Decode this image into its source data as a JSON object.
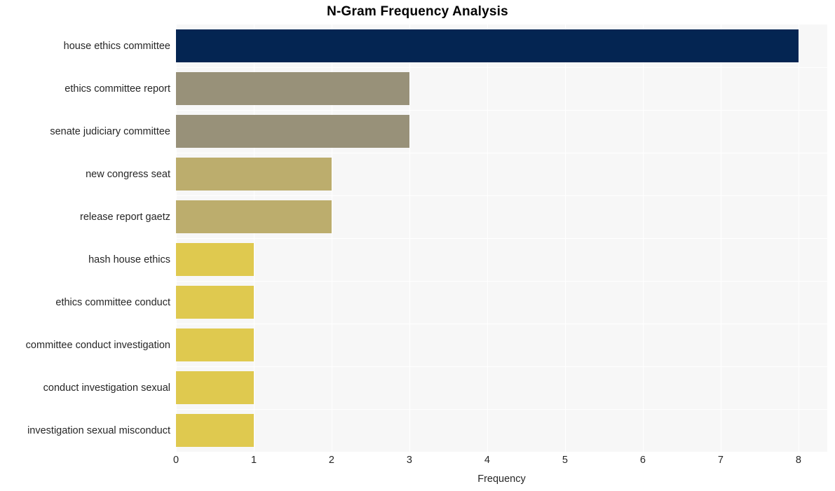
{
  "chart_data": {
    "type": "bar",
    "orientation": "horizontal",
    "title": "N-Gram Frequency Analysis",
    "xlabel": "Frequency",
    "ylabel": "",
    "categories": [
      "house ethics committee",
      "ethics committee report",
      "senate judiciary committee",
      "new congress seat",
      "release report gaetz",
      "hash house ethics",
      "ethics committee conduct",
      "committee conduct investigation",
      "conduct investigation sexual",
      "investigation sexual misconduct"
    ],
    "values": [
      8,
      3,
      3,
      2,
      2,
      1,
      1,
      1,
      1,
      1
    ],
    "bar_colors": [
      "#042552",
      "#989179",
      "#989179",
      "#bcad6d",
      "#bcad6d",
      "#dfc94f",
      "#dfc94f",
      "#dfc94f",
      "#dfc94f",
      "#dfc94f"
    ],
    "xticks": [
      0,
      1,
      2,
      3,
      4,
      5,
      6,
      7,
      8
    ],
    "xtick_labels": [
      "0",
      "1",
      "2",
      "3",
      "4",
      "5",
      "6",
      "7",
      "8"
    ],
    "xlim": [
      0,
      8.37
    ],
    "grid": true,
    "legend": false,
    "plot_background": "#f7f7f7",
    "figure_background": "#ffffff",
    "gridline_color": "#ffffff",
    "text_color": "#262626",
    "title_color": "#000000"
  }
}
